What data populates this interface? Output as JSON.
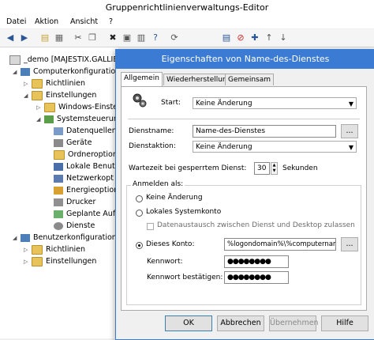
{
  "window": {
    "title": "Gruppenrichtlinienverwaltungs-Editor"
  },
  "menu": {
    "items": [
      "Datei",
      "Aktion",
      "Ansicht",
      "?"
    ]
  },
  "toolbar": {
    "icons": [
      "back-arrow",
      "forward-arrow",
      "folder-up",
      "tree-view",
      "scissors",
      "copy",
      "delete",
      "properties",
      "export",
      "help",
      "refresh",
      "stop",
      "add",
      "up",
      "down"
    ]
  },
  "tree": {
    "root": "_demo [MAJESTIX.GALLIER",
    "computer_config": "Computerkonfiguration",
    "richtlinien_1": "Richtlinien",
    "einstellungen_1": "Einstellungen",
    "windows_einst": "Windows-Einste",
    "systemsteuerung": "Systemsteuerung",
    "datenquellen": "Datenquellen",
    "geraete": "Geräte",
    "ordneroptionen": "Ordneroption",
    "lokale_benutzer": "Lokale Benut",
    "netzwerkoptionen": "Netzwerkopt",
    "energieoptionen": "Energieoption",
    "drucker": "Drucker",
    "geplante_aufgaben": "Geplante Auf",
    "dienste": "Dienste",
    "benutzer_config": "Benutzerkonfiguration",
    "richtlinien_2": "Richtlinien",
    "einstellungen_2": "Einstellungen"
  },
  "dialog": {
    "title": "Eigenschaften von Name-des-Dienstes",
    "tabs": [
      "Allgemein",
      "Wiederherstellung",
      "Gemeinsam"
    ],
    "start_label": "Start:",
    "start_value": "Keine Änderung",
    "dienstname_label": "Dienstname:",
    "dienstname_value": "Name-des-Dienstes",
    "browse_label": "...",
    "dienstaktion_label": "Dienstaktion:",
    "dienstaktion_value": "Keine Änderung",
    "wartezeit_label": "Wartezeit bei gesperrtem Dienst:",
    "wartezeit_value": "30",
    "sekunden_label": "Sekunden",
    "anmelden_label": "Anmelden als:",
    "radio_keine": "Keine Änderung",
    "radio_lokal": "Lokales Systemkonto",
    "checkbox_datenaustausch": "Datenaustausch zwischen Dienst und Desktop zulassen",
    "radio_konto": "Dieses Konto:",
    "konto_value": "%logondomain%\\%computernam",
    "kennwort_label": "Kennwort:",
    "kennwort_value": "●●●●●●●●",
    "kennwort_bestaetigen_label": "Kennwort bestätigen:",
    "kennwort_bestaetigen_value": "●●●●●●●●",
    "buttons": {
      "ok": "OK",
      "abbrechen": "Abbrechen",
      "uebernehmen": "Übernehmen",
      "hilfe": "Hilfe"
    }
  },
  "colors": {
    "accent": "#3b7bd4",
    "folder": "#e8c35a"
  }
}
